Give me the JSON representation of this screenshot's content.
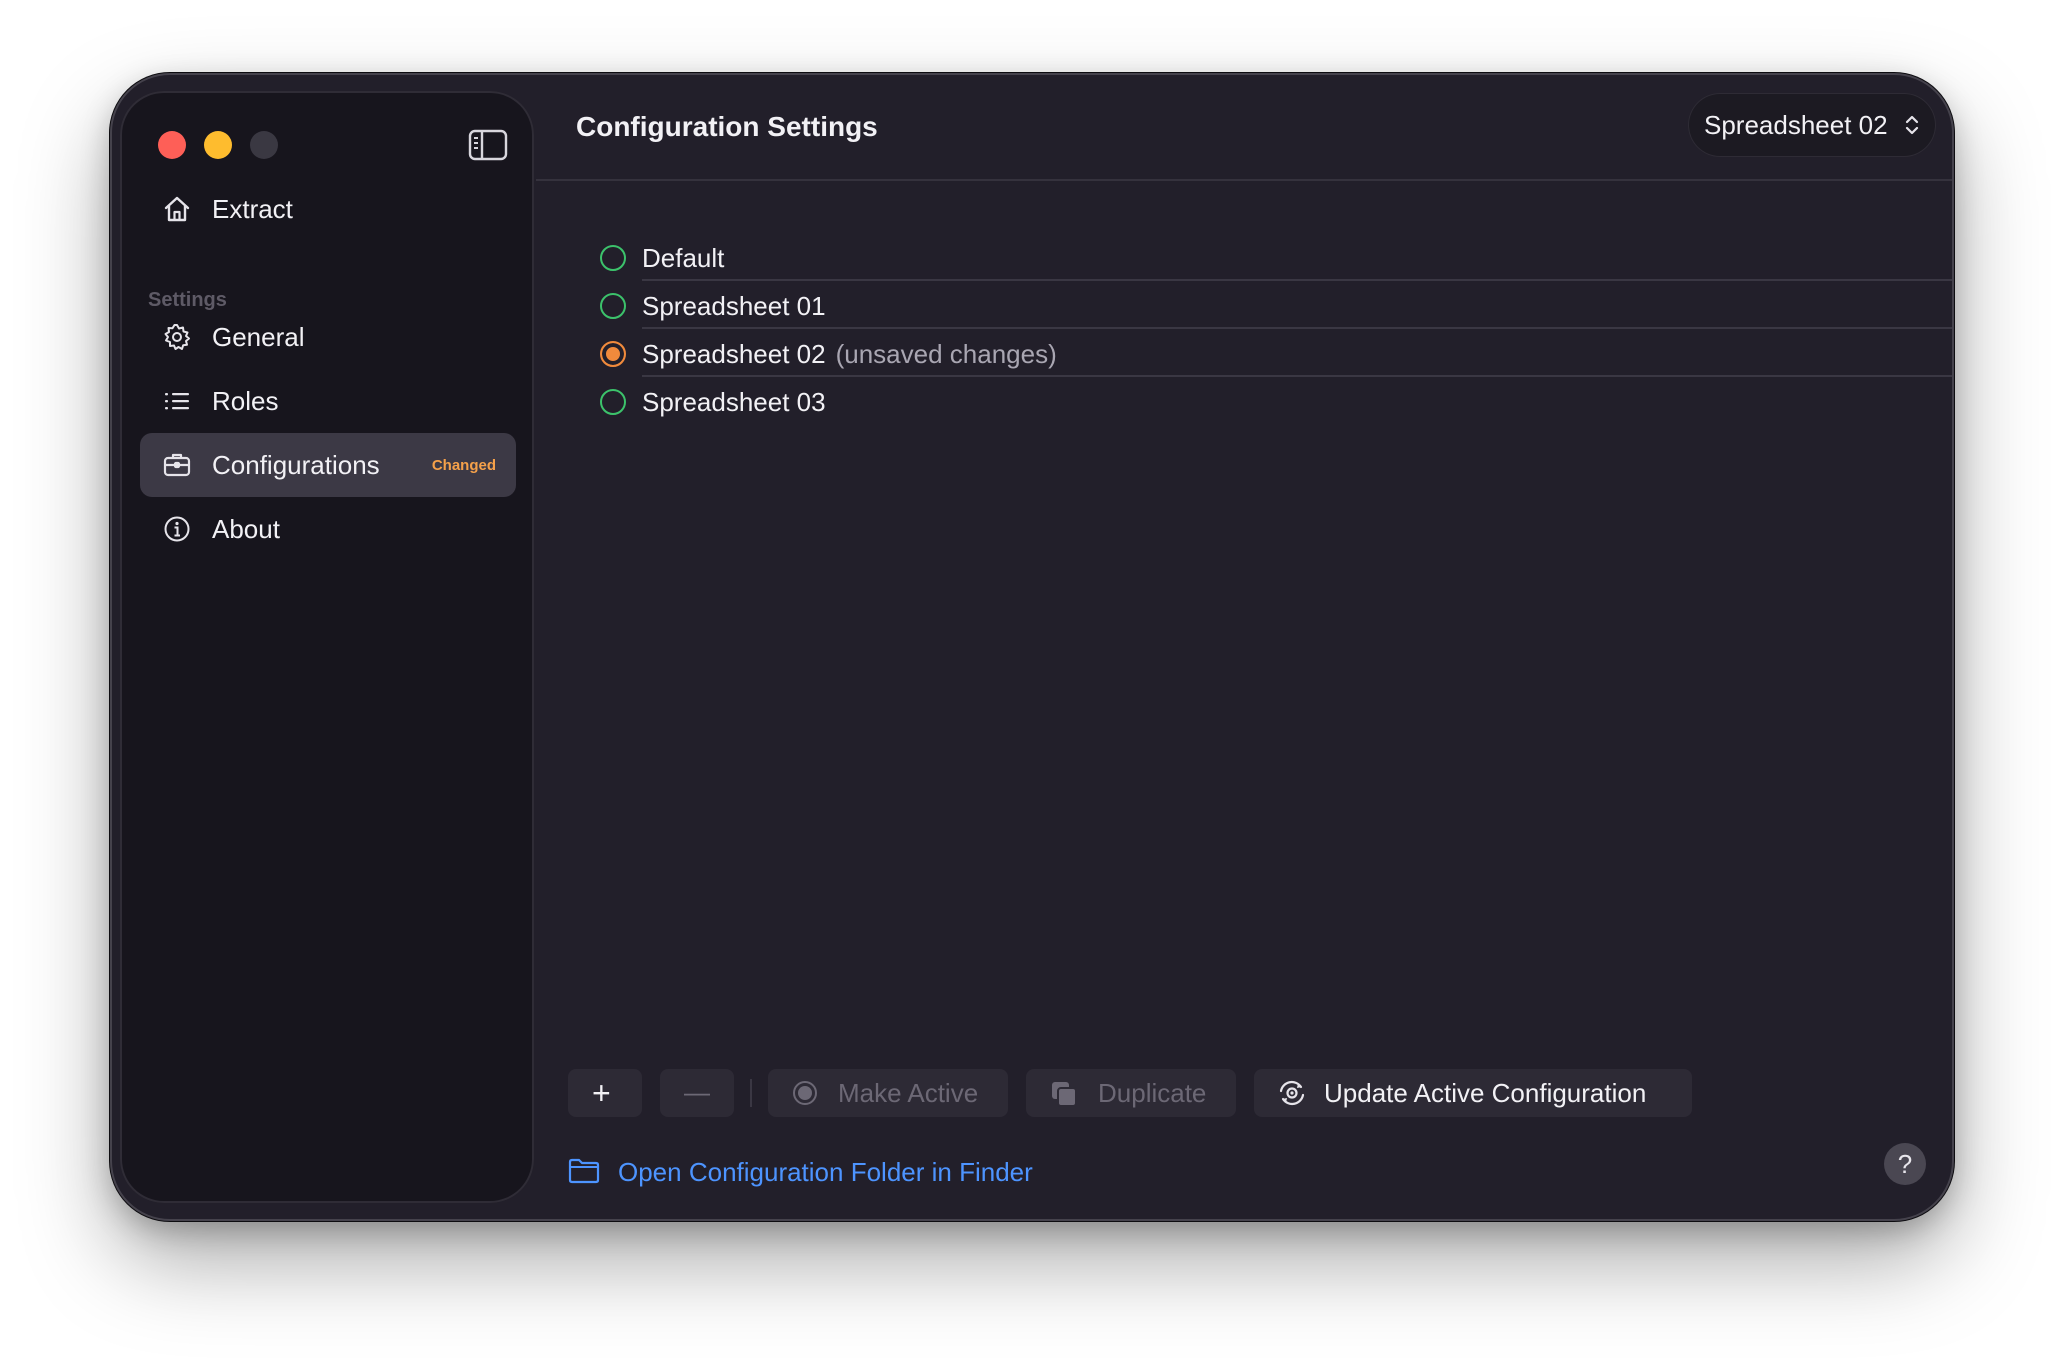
{
  "sidebar": {
    "top_item": {
      "label": "Extract",
      "icon": "house-icon"
    },
    "section_header": "Settings",
    "items": [
      {
        "label": "General",
        "icon": "gear-icon"
      },
      {
        "label": "Roles",
        "icon": "list-icon"
      },
      {
        "label": "Configurations",
        "icon": "briefcase-icon",
        "badge": "Changed",
        "selected": true
      },
      {
        "label": "About",
        "icon": "info-icon"
      }
    ]
  },
  "header": {
    "title": "Configuration Settings",
    "selected_config": "Spreadsheet 02"
  },
  "configs": [
    {
      "name": "Default",
      "note": "",
      "status": "available"
    },
    {
      "name": "Spreadsheet 01",
      "note": "",
      "status": "available"
    },
    {
      "name": "Spreadsheet 02",
      "note": "(unsaved changes)",
      "status": "active-unsaved"
    },
    {
      "name": "Spreadsheet 03",
      "note": "",
      "status": "available"
    }
  ],
  "toolbar": {
    "add_label": "+",
    "remove_label": "—",
    "make_active_label": "Make Active",
    "duplicate_label": "Duplicate",
    "update_label": "Update Active Configuration"
  },
  "footer": {
    "finder_link": "Open Configuration Folder in Finder",
    "help_label": "?"
  },
  "colors": {
    "window_bg": "#221f2a",
    "sidebar_bg": "#17151d",
    "selection_bg": "#3c3945",
    "accent_green": "#3cc26b",
    "accent_orange": "#f08a3c",
    "badge_orange": "#f5a14a",
    "link_blue": "#4d94ff"
  }
}
